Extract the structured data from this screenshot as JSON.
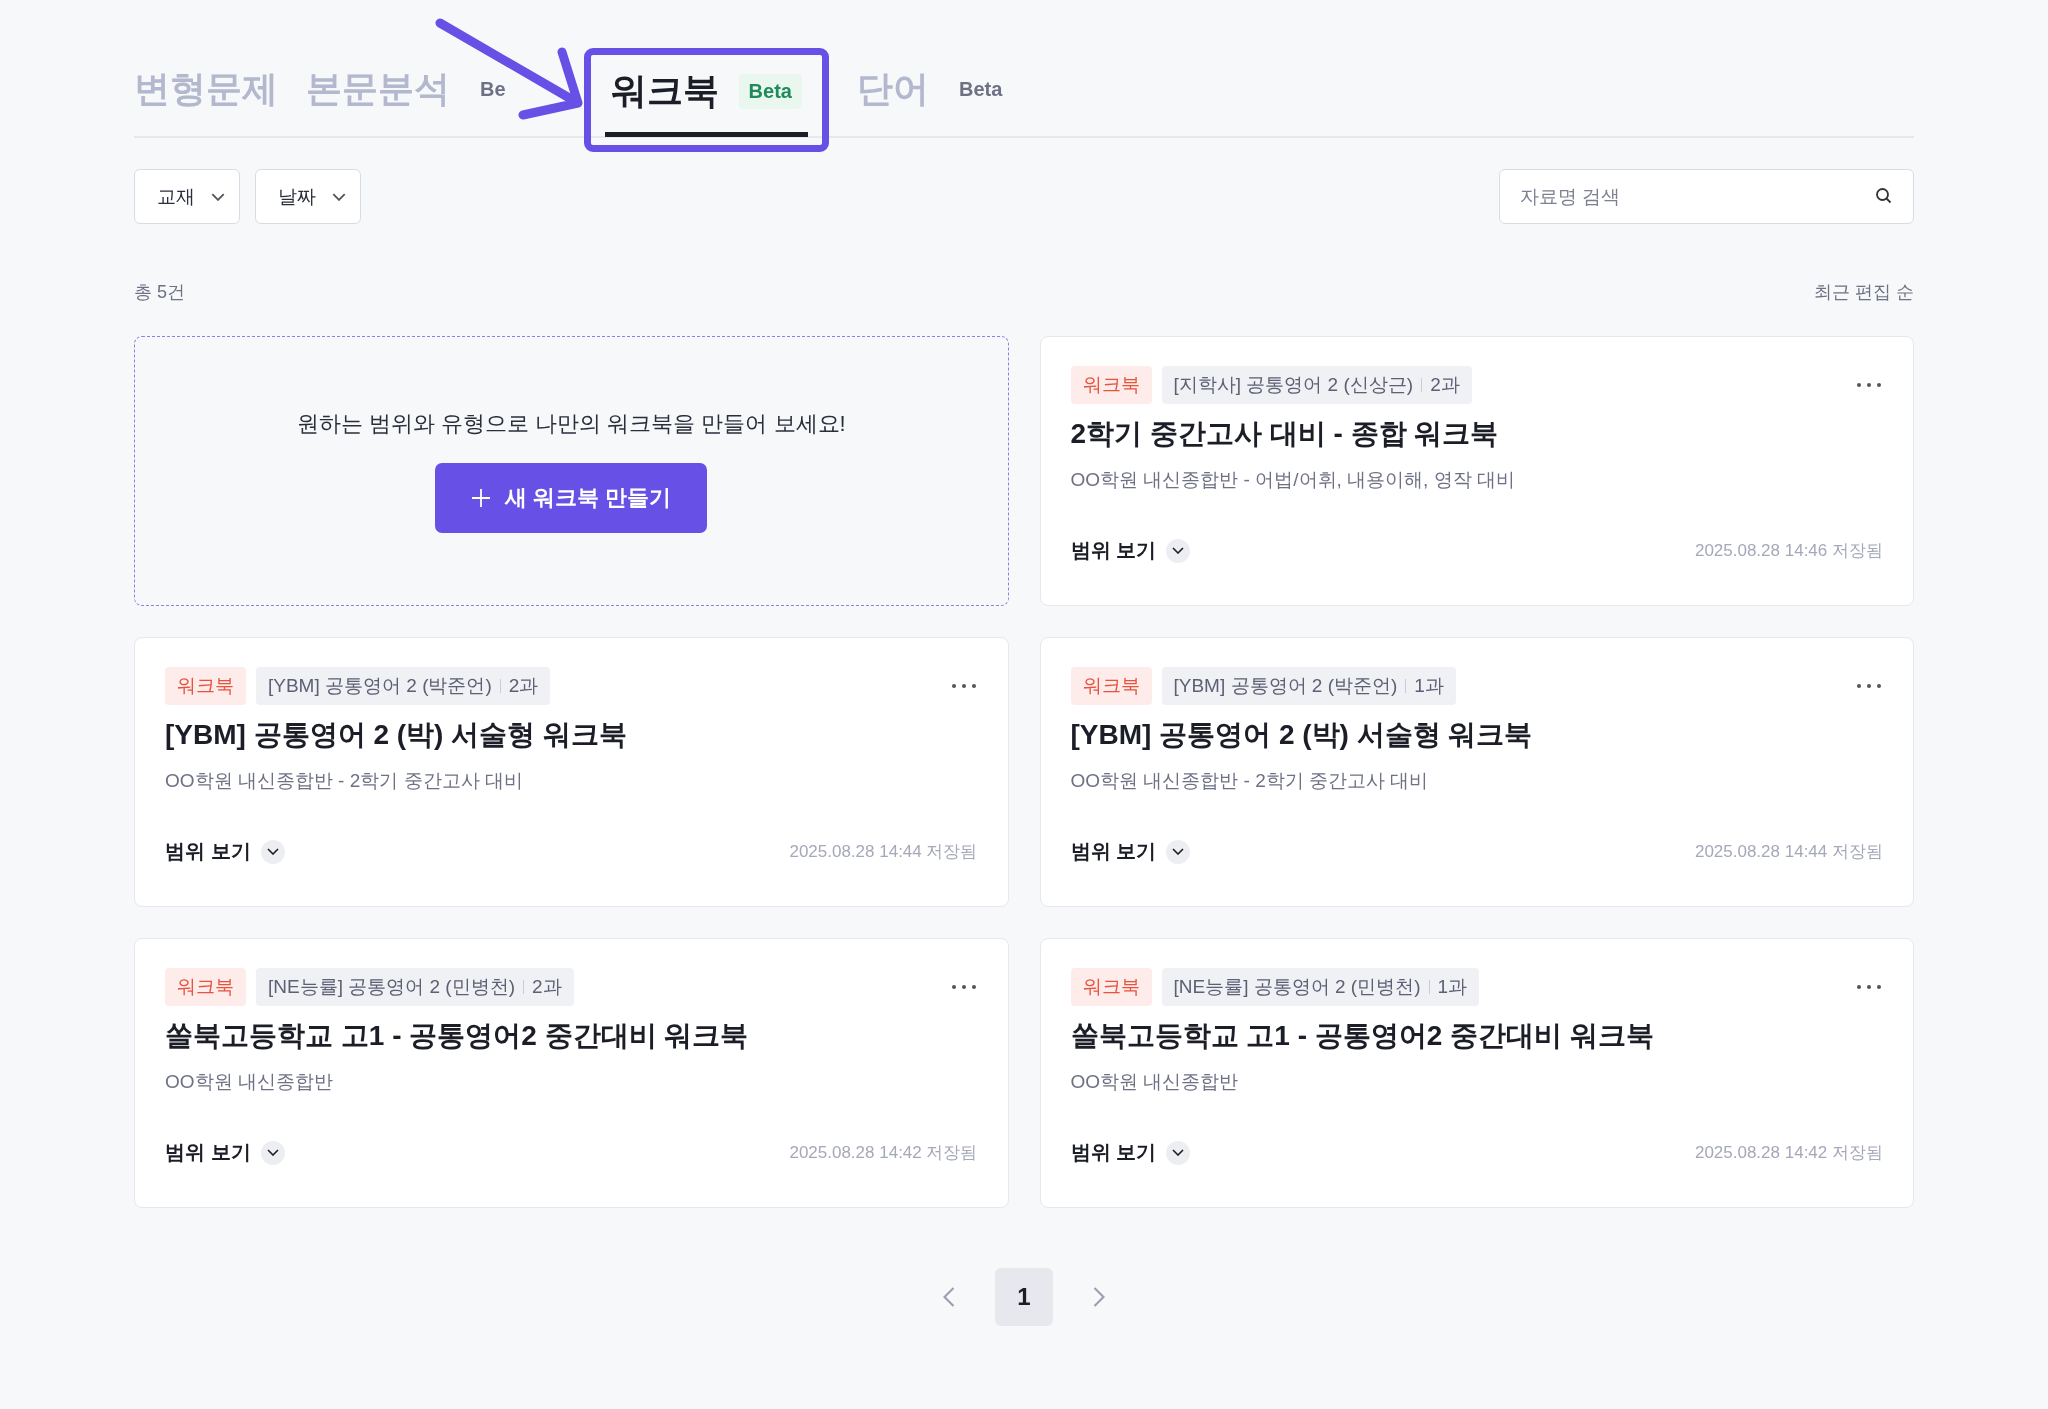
{
  "tabs": [
    {
      "label": "변형문제",
      "selected": false
    },
    {
      "label": "본문분석",
      "badge": "Be",
      "selected": false
    },
    {
      "label": "워크북",
      "badge": "Beta",
      "selected": true
    },
    {
      "label": "단어",
      "badge": "Beta",
      "selected": false
    }
  ],
  "filters": [
    {
      "label": "교재"
    },
    {
      "label": "날짜"
    }
  ],
  "search": {
    "placeholder": "자료명 검색"
  },
  "total": "총 5건",
  "sort": "최근 편집 순",
  "create_card": {
    "message": "원하는 범위와 유형으로 나만의 워크북을 만들어 보세요!",
    "button": "새 워크북 만들기"
  },
  "cards": [
    {
      "tag": "워크북",
      "source": "[지학사] 공통영어 2 (신상근)",
      "lesson": "2과",
      "title": "2학기 중간고사 대비 - 종합 워크북",
      "subtitle": "OO학원 내신종합반 - 어법/어휘, 내용이해, 영작 대비",
      "scope": "범위 보기",
      "saved": "2025.08.28 14:46 저장됨"
    },
    {
      "tag": "워크북",
      "source": "[YBM] 공통영어 2 (박준언)",
      "lesson": "2과",
      "title": "[YBM] 공통영어 2 (박) 서술형 워크북",
      "subtitle": "OO학원 내신종합반 - 2학기 중간고사 대비",
      "scope": "범위 보기",
      "saved": "2025.08.28 14:44 저장됨"
    },
    {
      "tag": "워크북",
      "source": "[YBM] 공통영어 2 (박준언)",
      "lesson": "1과",
      "title": "[YBM] 공통영어 2 (박) 서술형 워크북",
      "subtitle": "OO학원 내신종합반 - 2학기 중간고사 대비",
      "scope": "범위 보기",
      "saved": "2025.08.28 14:44 저장됨"
    },
    {
      "tag": "워크북",
      "source": "[NE능률] 공통영어 2 (민병천)",
      "lesson": "2과",
      "title": "쏠북고등학교 고1 - 공통영어2 중간대비 워크북",
      "subtitle": "OO학원 내신종합반",
      "scope": "범위 보기",
      "saved": "2025.08.28 14:42 저장됨"
    },
    {
      "tag": "워크북",
      "source": "[NE능률] 공통영어 2 (민병천)",
      "lesson": "1과",
      "title": "쏠북고등학교 고1 - 공통영어2 중간대비 워크북",
      "subtitle": "OO학원 내신종합반",
      "scope": "범위 보기",
      "saved": "2025.08.28 14:42 저장됨"
    }
  ],
  "pagination": {
    "pages": [
      {
        "label": "1",
        "selected": true
      }
    ]
  }
}
